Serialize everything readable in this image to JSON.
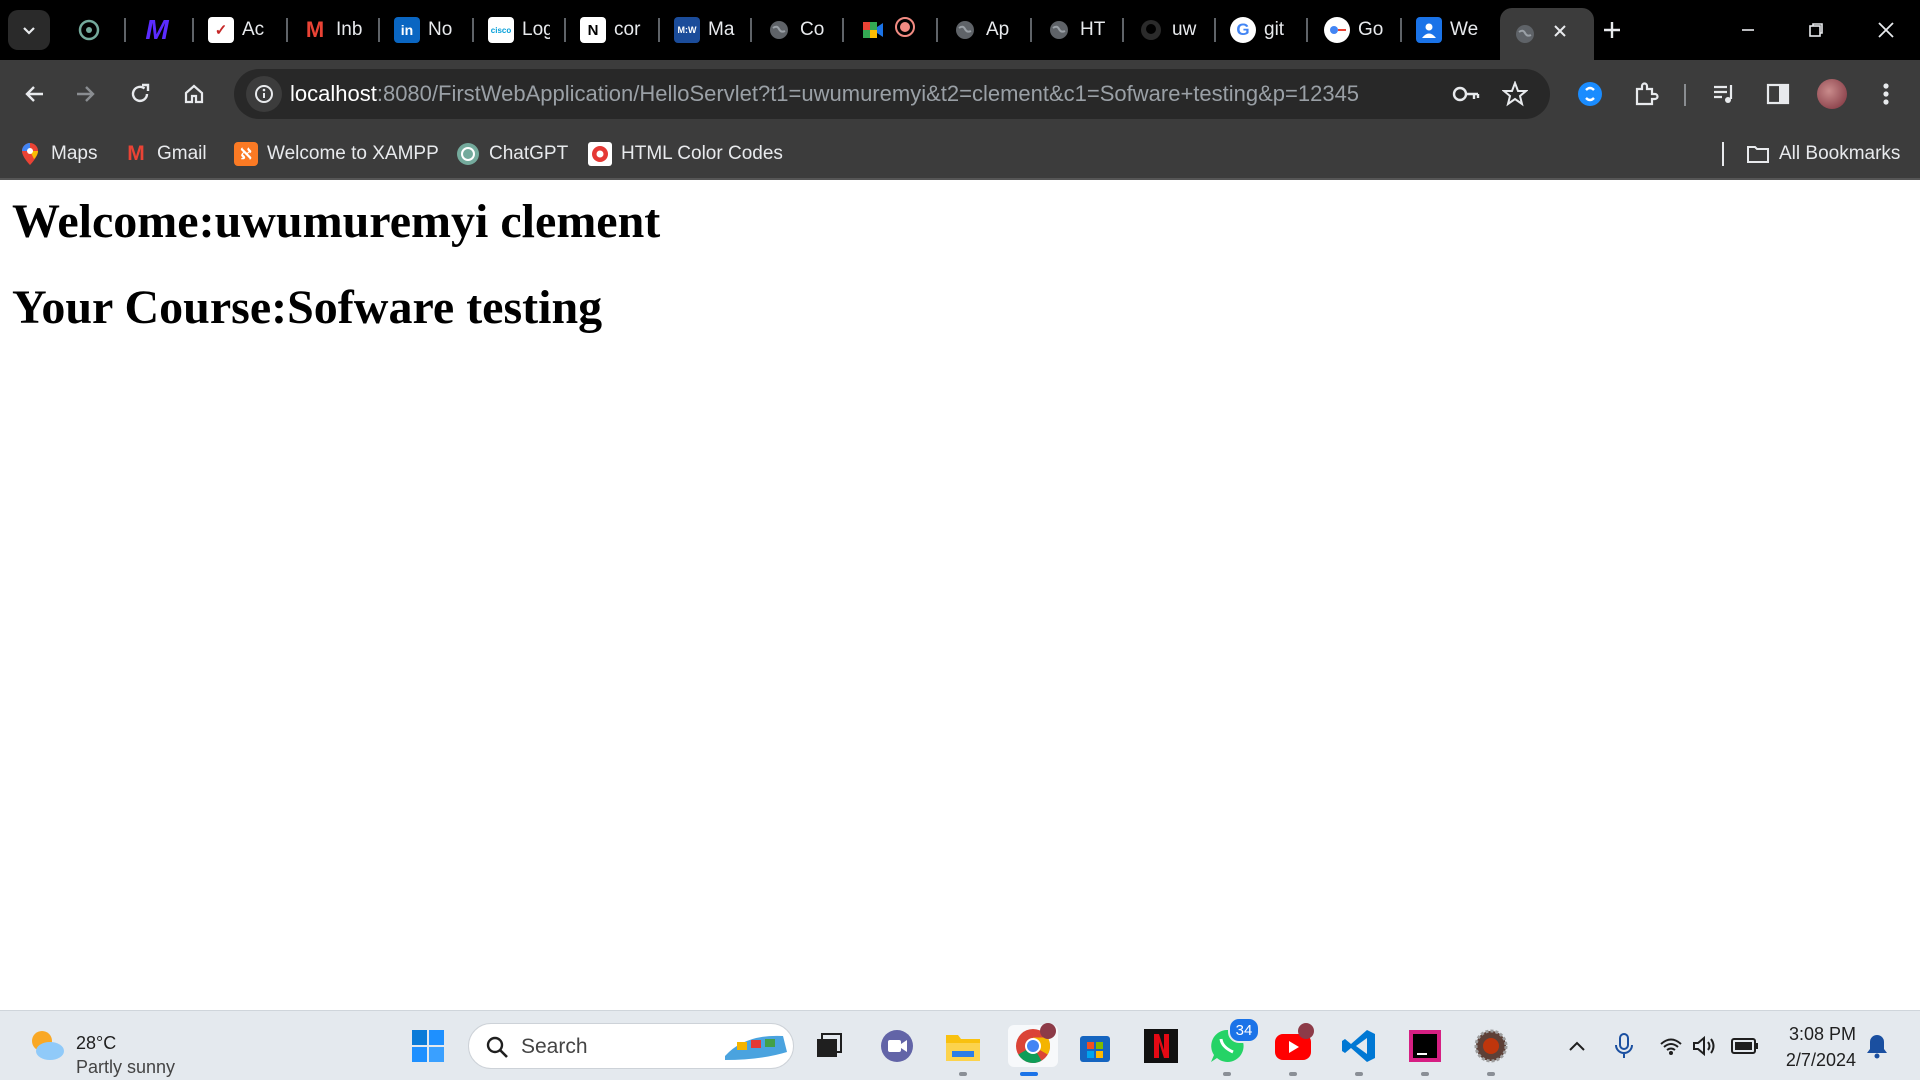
{
  "tabs": [
    {
      "label": "",
      "icon": "chatgpt-icon",
      "color": "#ffffff"
    },
    {
      "label": "",
      "icon": "m-logo-icon",
      "color": "#5b2bff"
    },
    {
      "label": "Ac",
      "icon": "check-icon",
      "color": "#ffffff"
    },
    {
      "label": "Inb",
      "icon": "gmail-icon",
      "color": "#ea4335"
    },
    {
      "label": "No",
      "icon": "linkedin-icon",
      "color": "#0a66c2"
    },
    {
      "label": "Log",
      "icon": "cisco-icon",
      "color": "#ffffff"
    },
    {
      "label": "cor",
      "icon": "notion-icon",
      "color": "#ffffff"
    },
    {
      "label": "Ma",
      "icon": "mdn-icon",
      "color": "#1b4c9a"
    },
    {
      "label": "Co",
      "icon": "globe-icon",
      "color": "#9aa0a6"
    },
    {
      "label": "",
      "icon": "meet-icon",
      "color": "#34a853"
    },
    {
      "label": "Ap",
      "icon": "globe-icon",
      "color": "#9aa0a6"
    },
    {
      "label": "HT",
      "icon": "globe-icon",
      "color": "#9aa0a6"
    },
    {
      "label": "uw",
      "icon": "github-icon",
      "color": "#ffffff"
    },
    {
      "label": "git",
      "icon": "google-icon",
      "color": "#ffffff"
    },
    {
      "label": "Go",
      "icon": "google-lens-icon",
      "color": "#ffffff"
    },
    {
      "label": "We",
      "icon": "contact-icon",
      "color": "#1a73e8"
    }
  ],
  "browser": {
    "url_host": "localhost",
    "url_rest": ":8080/FirstWebApplication/HelloServlet?t1=uwumuremyi&t2=clement&c1=Sofware+testing&p=12345"
  },
  "bookmarks": {
    "items": [
      {
        "label": "Maps"
      },
      {
        "label": "Gmail"
      },
      {
        "label": "Welcome to XAMPP"
      },
      {
        "label": "ChatGPT"
      },
      {
        "label": "HTML Color Codes"
      }
    ],
    "all_label": "All Bookmarks"
  },
  "page": {
    "welcome": "Welcome:uwumuremyi clement",
    "course": "Your Course:Sofware testing"
  },
  "taskbar": {
    "weather_temp": "28°C",
    "weather_desc": "Partly sunny",
    "search_placeholder": "Search",
    "whatsapp_badge": "34",
    "time": "3:08 PM",
    "date": "2/7/2024"
  },
  "colors": {
    "chrome_dark": "#3c3c3c",
    "accent": "#1a73e8"
  }
}
